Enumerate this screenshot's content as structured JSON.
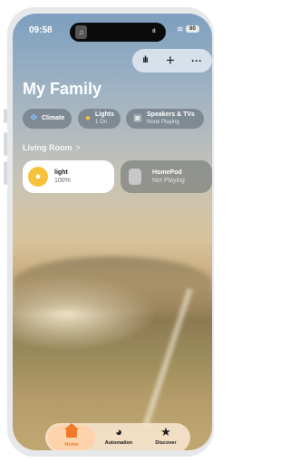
{
  "status": {
    "time": "09:58",
    "battery": "60"
  },
  "toolbar": {
    "voice_icon": "waveform-icon",
    "add_label": "+",
    "more_label": "···"
  },
  "title": "My Family",
  "chips": [
    {
      "label": "Climate",
      "sub": ""
    },
    {
      "label": "Lights",
      "sub": "1 On"
    },
    {
      "label": "Speakers & TVs",
      "sub": "None Playing"
    }
  ],
  "section": {
    "label": "Living Room",
    "chevron": ">"
  },
  "accessories": [
    {
      "name": "light",
      "state": "100%"
    },
    {
      "name": "HomePod",
      "state": "Not Playing"
    }
  ],
  "tabs": [
    {
      "label": "Home"
    },
    {
      "label": "Automation"
    },
    {
      "label": "Discover"
    }
  ],
  "colors": {
    "accent": "#f07a2a",
    "bulb": "#f6c23b"
  }
}
